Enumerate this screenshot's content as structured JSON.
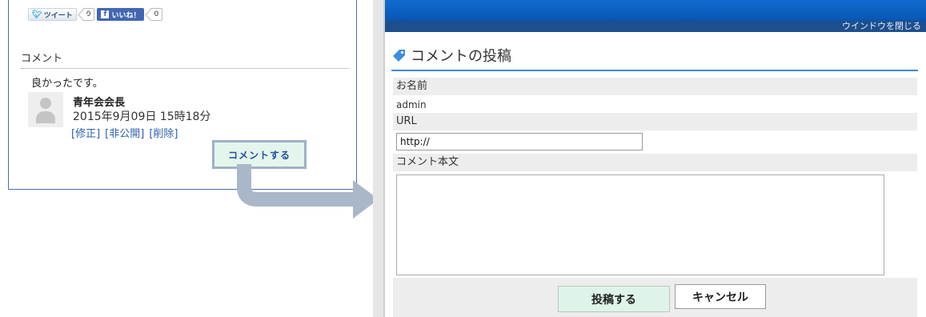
{
  "left": {
    "share": {
      "tweet_label": "ツイート",
      "tweet_count": "0",
      "like_label": "いいね！",
      "like_count": "0"
    },
    "section_title": "コメント",
    "comment": {
      "text": "良かったです。",
      "author": "青年会会長",
      "date": "2015年9月09日 15時18分",
      "actions": [
        "[修正]",
        "[非公開]",
        "[削除]"
      ]
    },
    "comment_button": "コメントする"
  },
  "dialog": {
    "close_label": "ウインドウを閉じる",
    "title": "コメントの投稿",
    "name_label": "お名前",
    "name_value": "admin",
    "url_label": "URL",
    "url_value": "http://",
    "body_label": "コメント本文",
    "body_value": "",
    "submit_label": "投稿する",
    "cancel_label": "キャンセル"
  },
  "colors": {
    "accent_blue": "#0f6bd0",
    "title_underline": "#3d8ad6",
    "link_blue": "#2b5fb0",
    "button_green": "#dff4e8",
    "arrow_gray": "#a9b7c8"
  },
  "icons": [
    "twitter-bird-icon",
    "facebook-icon",
    "default-avatar-icon",
    "tag-icon",
    "arrow-icon"
  ]
}
